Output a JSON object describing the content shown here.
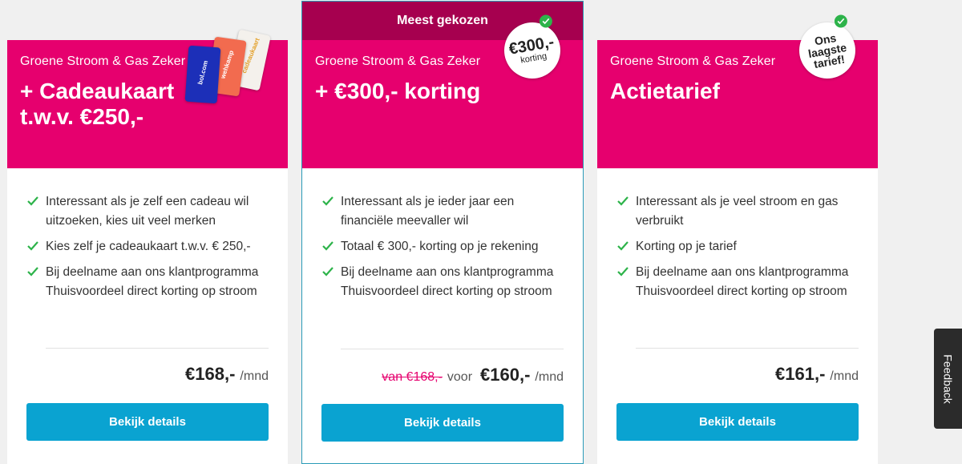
{
  "cards": [
    {
      "subtitle": "Groene Stroom & Gas Zeker",
      "title_line1": "+ Cadeaukaart",
      "title_line2": "t.w.v. €250,-",
      "giftcards": [
        "bol.com",
        "wehkamp",
        "cadeaukaart"
      ],
      "features": [
        "Interessant als je zelf een cadeau wil uitzoeken, kies uit veel merken",
        "Kies zelf je cadeaukaart t.w.v. € 250,-",
        "Bij deelname aan ons klantprogramma Thuisvoordeel direct korting op stroom"
      ],
      "price": "€168,-",
      "per": "/mnd",
      "button": "Bekijk details"
    },
    {
      "ribbon": "Meest gekozen",
      "subtitle": "Groene Stroom & Gas Zeker",
      "title_line1": "+ €300,- korting",
      "badge_big": "€300,-",
      "badge_small": "korting",
      "features": [
        "Interessant als je ieder jaar een financiële meevaller wil",
        "Totaal € 300,- korting op je rekening",
        "Bij deelname aan ons klantprogramma Thuisvoordeel direct korting op stroom"
      ],
      "old_price": "van €168,-",
      "voor": "voor",
      "price": "€160,-",
      "per": "/mnd",
      "button": "Bekijk details"
    },
    {
      "subtitle": "Groene Stroom & Gas Zeker",
      "title_line1": "Actietarief",
      "badge_lines": [
        "Ons",
        "laagste",
        "tarief!"
      ],
      "features": [
        "Interessant als je veel stroom en gas verbruikt",
        "Korting op je tarief",
        "Bij deelname aan ons klantprogramma Thuisvoordeel direct korting op stroom"
      ],
      "price": "€161,-",
      "per": "/mnd",
      "button": "Bekijk details"
    }
  ],
  "feedback": "Feedback",
  "colors": {
    "brand": "#e6006e",
    "ribbon": "#a6004f",
    "button": "#0aa3d1",
    "check": "#2db34a"
  },
  "icons": {
    "feature": "check-icon",
    "badge": "check-circle-icon"
  }
}
